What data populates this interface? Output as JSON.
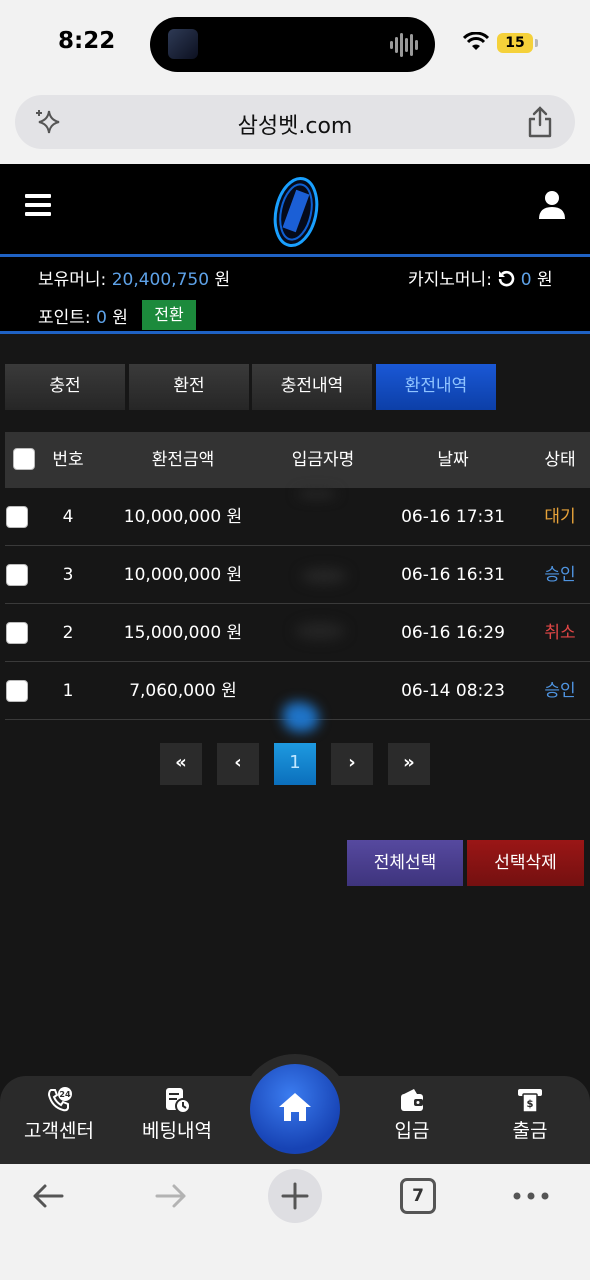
{
  "status_bar": {
    "time": "8:22",
    "battery": "15"
  },
  "address_bar": {
    "url": "삼성벳.com"
  },
  "balance": {
    "money_label": "보유머니: ",
    "money_value": "20,400,750",
    "money_unit": " 원",
    "casino_label": "카지노머니: ",
    "casino_value": "0",
    "casino_unit": " 원",
    "point_label": "포인트: ",
    "point_value": "0",
    "point_unit": " 원",
    "exchange_button": "전환"
  },
  "tabs": [
    {
      "label": "충전",
      "active": false
    },
    {
      "label": "환전",
      "active": false
    },
    {
      "label": "충전내역",
      "active": false
    },
    {
      "label": "환전내역",
      "active": true
    }
  ],
  "table": {
    "headers": [
      "번호",
      "환전금액",
      "입금자명",
      "날짜",
      "상태"
    ],
    "rows": [
      {
        "no": "4",
        "amount": "10,000,000 원",
        "depositor": "",
        "date": "06-16 17:31",
        "status": "대기",
        "status_color": "#e8a33a"
      },
      {
        "no": "3",
        "amount": "10,000,000 원",
        "depositor": "",
        "date": "06-16 16:31",
        "status": "승인",
        "status_color": "#4f94e0"
      },
      {
        "no": "2",
        "amount": "15,000,000 원",
        "depositor": "",
        "date": "06-16 16:29",
        "status": "취소",
        "status_color": "#e04646"
      },
      {
        "no": "1",
        "amount": "7,060,000 원",
        "depositor": "",
        "date": "06-14 08:23",
        "status": "승인",
        "status_color": "#4f94e0"
      }
    ]
  },
  "pagination": {
    "first": "«",
    "prev": "‹",
    "current": "1",
    "next": "›",
    "last": "»"
  },
  "actions": {
    "select_all": "전체선택",
    "delete_selected": "선택삭제"
  },
  "bottom_nav": {
    "support": "고객센터",
    "betting": "베팅내역",
    "deposit": "입금",
    "withdraw": "출금"
  },
  "browser": {
    "tab_count": "7"
  },
  "colors": {
    "accent_blue": "#1f62c4",
    "green": "#1c8a3c",
    "select_all_bg": "#4a3f8f",
    "delete_bg": "#8b1212"
  }
}
